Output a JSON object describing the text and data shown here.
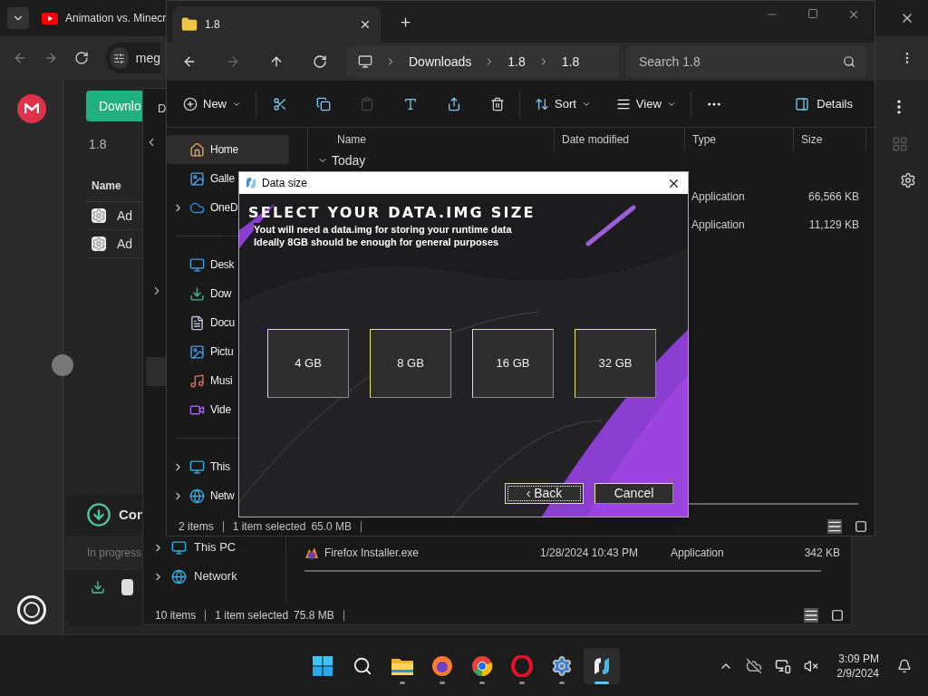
{
  "browser": {
    "tab_title": "Animation vs. Minecr",
    "address": "meg",
    "download_button": "Downlo",
    "folder": "1.8",
    "column": "Name",
    "rows": [
      "Ad",
      "Ad"
    ],
    "transfer_panel": {
      "title": "Con",
      "status": "In progress"
    }
  },
  "explorer_back": {
    "toolbar_text": "D",
    "nav": [
      {
        "label": "This PC",
        "expandable": true
      },
      {
        "label": "Network",
        "expandable": true
      }
    ],
    "files": [
      {
        "name": "Firefox Installer.exe",
        "date": "1/28/2024 10:43 PM",
        "type": "Application",
        "size": "342 KB"
      }
    ],
    "status": {
      "items": "10 items",
      "selected": "1 item selected",
      "size": "75.8 MB"
    }
  },
  "explorer": {
    "tab": "1.8",
    "breadcrumbs": [
      "Downloads",
      "1.8",
      "1.8"
    ],
    "search_placeholder": "Search 1.8",
    "new": "New",
    "sort": "Sort",
    "view": "View",
    "details": "Details",
    "nav_groups": [
      [
        {
          "label": "Home",
          "kind": "home",
          "expandable": false,
          "selected": true
        },
        {
          "label": "Galle",
          "kind": "gallery",
          "expandable": false,
          "selected": false
        },
        {
          "label": "OneD",
          "kind": "cloud",
          "expandable": true,
          "selected": false
        }
      ],
      [
        {
          "label": "Desk",
          "kind": "desktop",
          "expandable": false,
          "selected": false
        },
        {
          "label": "Dow",
          "kind": "downloads",
          "expandable": false,
          "selected": false
        },
        {
          "label": "Docu",
          "kind": "documents",
          "expandable": false,
          "selected": false
        },
        {
          "label": "Pictu",
          "kind": "pictures",
          "expandable": false,
          "selected": false
        },
        {
          "label": "Musi",
          "kind": "music",
          "expandable": false,
          "selected": false
        },
        {
          "label": "Vide",
          "kind": "videos",
          "expandable": false,
          "selected": false
        }
      ],
      [
        {
          "label": "This",
          "kind": "pc",
          "expandable": true,
          "selected": false
        },
        {
          "label": "Netw",
          "kind": "network",
          "expandable": true,
          "selected": false
        }
      ]
    ],
    "columns": [
      "Name",
      "Date modified",
      "Type",
      "Size"
    ],
    "group": "Today",
    "files": [
      {
        "type": "Application",
        "size": "66,566 KB"
      },
      {
        "type": "Application",
        "size": "11,129 KB"
      }
    ],
    "status": {
      "items": "2 items",
      "selected": "1 item selected",
      "size": "65.0 MB"
    }
  },
  "dialog": {
    "title": "Data size",
    "heading": "SELECT YOUR DATA.IMG SIZE",
    "lines": [
      "Yout will need a data.img for storing your runtime data",
      "Ideally 8GB should be enough for general purposes"
    ],
    "options": [
      "4 GB",
      "8 GB",
      "16 GB",
      "32 GB"
    ],
    "buttons": [
      {
        "label": "‹ Back",
        "focused": true
      },
      {
        "label": "Cancel",
        "focused": false
      }
    ]
  },
  "taskbar": {
    "apps": [
      {
        "kind": "start",
        "running": false,
        "active": false
      },
      {
        "kind": "search",
        "running": false,
        "active": false
      },
      {
        "kind": "files",
        "running": true,
        "active": false
      },
      {
        "kind": "firefox",
        "running": true,
        "active": false
      },
      {
        "kind": "chrome",
        "running": true,
        "active": false
      },
      {
        "kind": "opera",
        "running": true,
        "active": false
      },
      {
        "kind": "settings",
        "running": true,
        "active": false
      },
      {
        "kind": "app",
        "running": true,
        "active": true
      }
    ],
    "time": "3:09 PM",
    "date": "2/9/2024"
  }
}
